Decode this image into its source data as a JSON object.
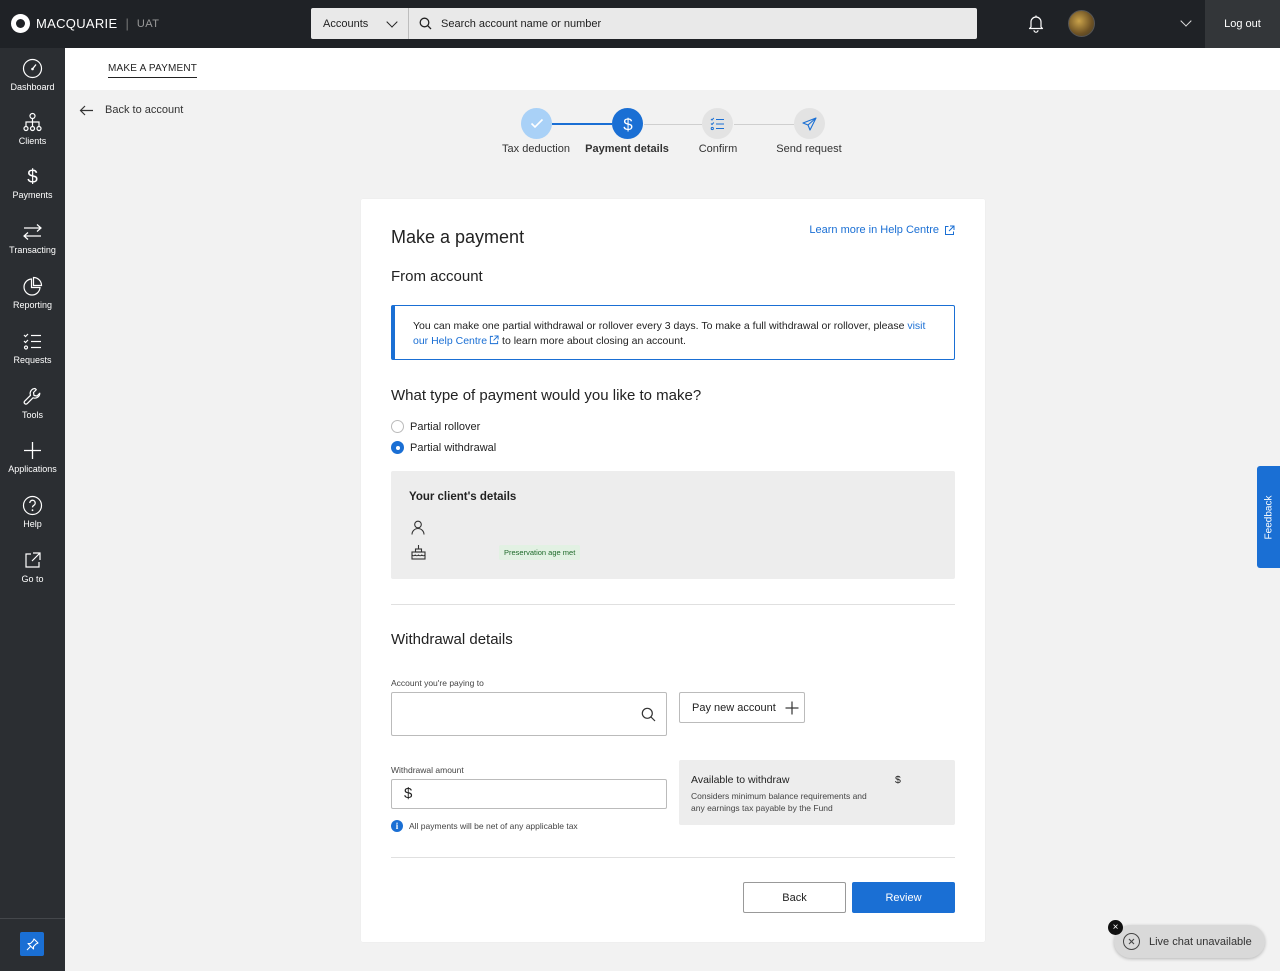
{
  "brand": {
    "name": "MACQUARIE",
    "separator": "|",
    "env": "UAT"
  },
  "header": {
    "scope_label": "Accounts",
    "search_placeholder": "Search account name or number",
    "logout_label": "Log out"
  },
  "sidebar": {
    "items": [
      {
        "label": "Dashboard",
        "icon": "dashboard-icon"
      },
      {
        "label": "Clients",
        "icon": "clients-icon"
      },
      {
        "label": "Payments",
        "icon": "dollar-icon"
      },
      {
        "label": "Transacting",
        "icon": "transfer-arrows-icon"
      },
      {
        "label": "Reporting",
        "icon": "pie-chart-icon"
      },
      {
        "label": "Requests",
        "icon": "checklist-icon"
      },
      {
        "label": "Tools",
        "icon": "wrench-icon"
      },
      {
        "label": "Applications",
        "icon": "plus-icon"
      },
      {
        "label": "Help",
        "icon": "help-icon"
      },
      {
        "label": "Go to",
        "icon": "external-link-icon"
      }
    ]
  },
  "page": {
    "tab": "MAKE A PAYMENT",
    "back_label": "Back to account"
  },
  "stepper": {
    "steps": [
      {
        "label": "Tax deduction",
        "state": "done"
      },
      {
        "label": "Payment details",
        "state": "active"
      },
      {
        "label": "Confirm",
        "state": "todo"
      },
      {
        "label": "Send request",
        "state": "todo"
      }
    ]
  },
  "form": {
    "title": "Make a payment",
    "help_link": "Learn more in Help Centre",
    "from_account": "From account",
    "info": {
      "text_before": "You can make one partial withdrawal or rollover every 3 days. To make a full withdrawal or rollover, please ",
      "link_text_1": "visit",
      "link_text_2": "our Help Centre",
      "text_after": " to learn more about closing an account."
    },
    "question": "What type of payment would you like to make?",
    "options": [
      {
        "label": "Partial rollover",
        "selected": false
      },
      {
        "label": "Partial withdrawal",
        "selected": true
      }
    ],
    "client_details_title": "Your client's details",
    "preservation_badge": "Preservation age met",
    "withdrawal_title": "Withdrawal details",
    "account_label": "Account you're paying to",
    "account_value": "",
    "pay_new_label": "Pay new account",
    "amount_label": "Withdrawal amount",
    "amount_currency": "$",
    "amount_value": "",
    "net_note": "All payments will be net of any applicable tax",
    "available": {
      "title": "Available to withdraw",
      "value": "$",
      "desc": "Considers minimum balance requirements and any earnings tax payable by the Fund"
    },
    "back_button": "Back",
    "review_button": "Review"
  },
  "feedback_label": "Feedback",
  "chat": {
    "label": "Live chat unavailable",
    "close": "×"
  },
  "colors": {
    "accent": "#1a6fd4",
    "topbar": "#1f2226",
    "sidebar": "#2b2e32",
    "step_done": "#a9d1f7"
  }
}
